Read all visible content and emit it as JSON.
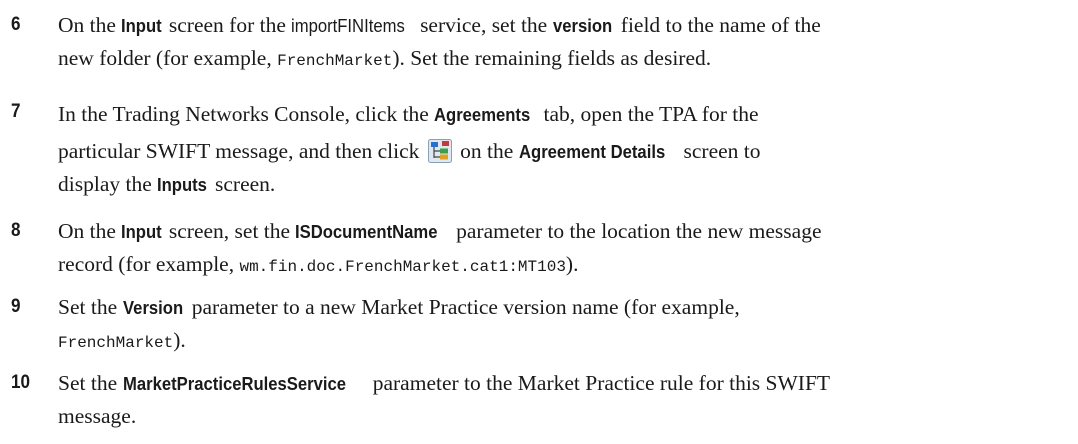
{
  "steps": [
    {
      "number": "6",
      "t1": "On the ",
      "b1": "Input",
      "t2": " screen for the ",
      "p1": "importFINItems",
      "t3": " service, set the ",
      "b2": "version",
      "t4": " field to the name of the",
      "t5": "new folder (for example, ",
      "c1": "FrenchMarket",
      "t6": "). Set the remaining fields as desired."
    },
    {
      "number": "7",
      "t1": "In the Trading Networks Console, click the ",
      "b1": "Agreements",
      "t2": " tab, open the TPA for the",
      "t3": "particular SWIFT message, and then click ",
      "icon": "tree-icon",
      "t4": " on the ",
      "b2": "Agreement Details",
      "t5": " screen to",
      "t6": "display the ",
      "b3": "Inputs",
      "t7": " screen."
    },
    {
      "number": "8",
      "t1": "On the ",
      "b1": "Input",
      "t2": " screen, set the ",
      "b2": "ISDocumentName",
      "t3": " parameter to the location the new message",
      "t4": "record (for example, ",
      "c1": "wm.fin.doc.FrenchMarket.cat1:MT103",
      "t5": ")."
    },
    {
      "number": "9",
      "t1": "Set the ",
      "b1": "Version",
      "t2": " parameter to a new Market Practice version name (for example,",
      "c1": "FrenchMarket",
      "t3": ")."
    },
    {
      "number": "10",
      "t1": "Set the ",
      "b1": "MarketPracticeRulesService",
      "t2": " parameter to the Market Practice rule for this SWIFT",
      "t3": "message."
    }
  ],
  "colors": {
    "text": "#1a1a1a",
    "background": "#ffffff"
  }
}
